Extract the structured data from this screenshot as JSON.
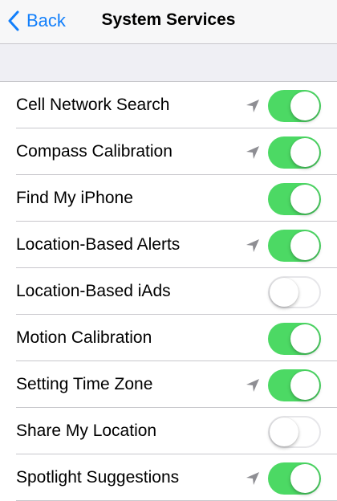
{
  "nav": {
    "back_label": "Back",
    "title": "System Services"
  },
  "colors": {
    "accent": "#127ffb",
    "toggle_on": "#4cd964",
    "location_arrow": "#8e8e93"
  },
  "services": [
    {
      "label": "Cell Network Search",
      "location_icon": true,
      "enabled": true
    },
    {
      "label": "Compass Calibration",
      "location_icon": true,
      "enabled": true
    },
    {
      "label": "Find My iPhone",
      "location_icon": false,
      "enabled": true
    },
    {
      "label": "Location-Based Alerts",
      "location_icon": true,
      "enabled": true
    },
    {
      "label": "Location-Based iAds",
      "location_icon": false,
      "enabled": false
    },
    {
      "label": "Motion Calibration",
      "location_icon": false,
      "enabled": true
    },
    {
      "label": "Setting Time Zone",
      "location_icon": true,
      "enabled": true
    },
    {
      "label": "Share My Location",
      "location_icon": false,
      "enabled": false
    },
    {
      "label": "Spotlight Suggestions",
      "location_icon": true,
      "enabled": true
    }
  ]
}
